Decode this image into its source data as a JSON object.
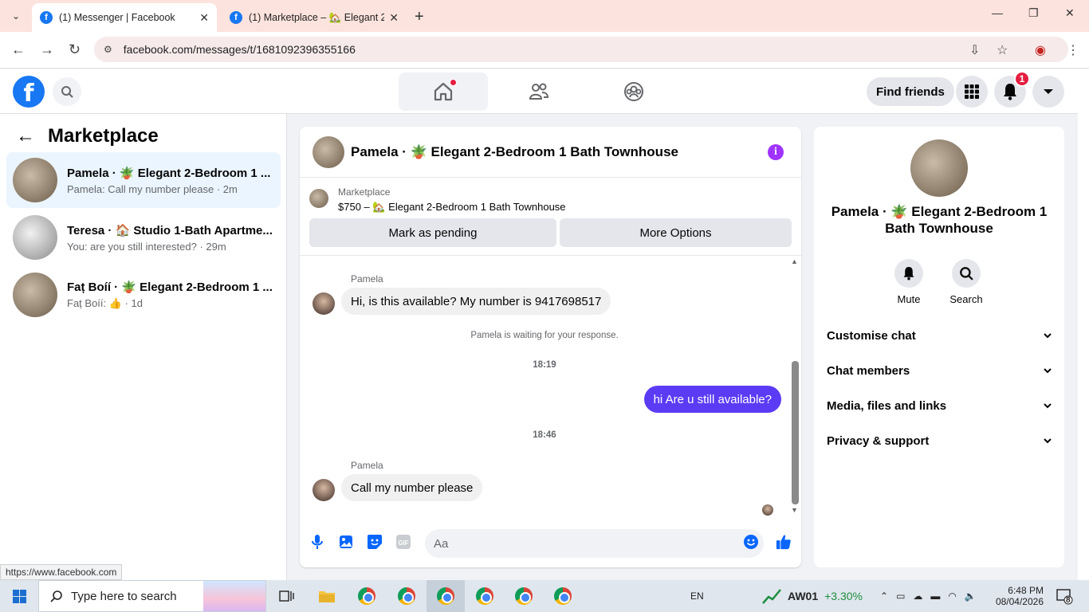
{
  "browser": {
    "tabs": [
      {
        "title": "(1) Messenger | Facebook",
        "active": true
      },
      {
        "title": "(1) Marketplace – 🏡 Elegant 2",
        "active": false
      }
    ],
    "url": "facebook.com/messages/t/1681092396355166",
    "status_url": "https://www.facebook.com"
  },
  "fb_nav": {
    "logo": "f",
    "find_friends": "Find friends",
    "notification_count": "1"
  },
  "left_panel": {
    "title": "Marketplace",
    "conversations": [
      {
        "name": "Pamela · 🪴 Elegant 2-Bedroom 1 ...",
        "preview": "Pamela: Call my number please · 2m",
        "selected": true
      },
      {
        "name": "Teresa · 🏠 Studio 1-Bath Apartme...",
        "preview": "You: are you still interested? · 29m",
        "selected": false
      },
      {
        "name": "Faț Boíí · 🪴 Elegant 2-Bedroom 1 ...",
        "preview": "Faț Boíí: 👍 · 1d",
        "selected": false
      }
    ]
  },
  "chat": {
    "header_name": "Pamela · 🪴 Elegant 2-Bedroom 1 Bath Townhouse",
    "marketplace_label": "Marketplace",
    "listing": "$750 – 🏡 Elegant 2-Bedroom 1 Bath Townhouse",
    "mark_pending": "Mark as pending",
    "more_options": "More Options",
    "messages": [
      {
        "sender": "Pamela",
        "text": "Hi, is this available? My number is 9417698517"
      },
      {
        "system": "Pamela is waiting for your response."
      },
      {
        "time": "18:19"
      },
      {
        "outgoing": "hi Are u still available?"
      },
      {
        "time": "18:46"
      },
      {
        "sender": "Pamela",
        "text": "Call my number please"
      }
    ],
    "composer_placeholder": "Aa"
  },
  "right_panel": {
    "name": "Pamela · 🪴 Elegant 2-Bedroom 1 Bath Townhouse",
    "actions": [
      "Mute",
      "Search"
    ],
    "sections": [
      "Customise chat",
      "Chat members",
      "Media, files and links",
      "Privacy & support"
    ]
  },
  "taskbar": {
    "search_placeholder": "Type here to search",
    "lang": "EN",
    "stock_name": "AW01",
    "stock_change": "+3.30%",
    "time": "6:48 PM",
    "date": "08/04/2026",
    "notif_count": "8"
  },
  "colors": {
    "fb_blue": "#1877f2",
    "outgoing_bubble": "#5b3cf4",
    "badge_red": "#e41e3f",
    "info_purple": "#a033ff"
  }
}
